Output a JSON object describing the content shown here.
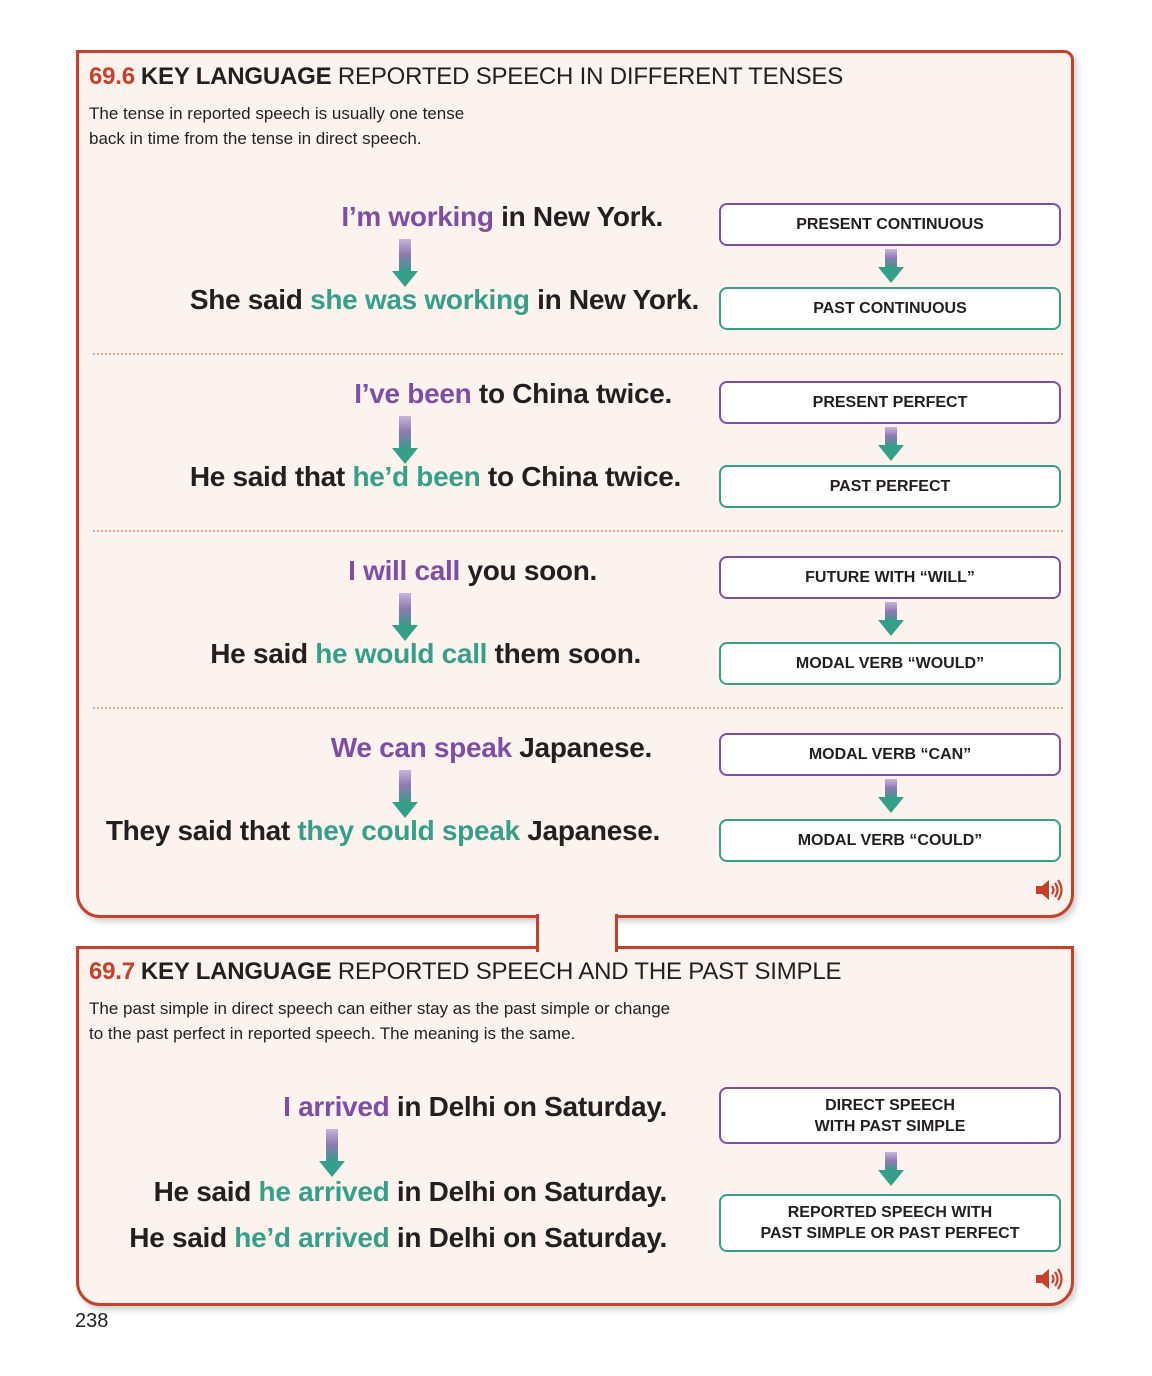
{
  "section1": {
    "number": "69.6",
    "key": "KEY LANGUAGE",
    "title": "REPORTED SPEECH IN DIFFERENT TENSES",
    "intro_line1": "The tense in reported speech is usually one tense",
    "intro_line2": "back in time from the tense in direct speech.",
    "pairs": [
      {
        "direct": {
          "highlight": "I’m working",
          "rest": " in New York."
        },
        "reported": {
          "pre": "She said ",
          "highlight": "she was working",
          "post": " in New York."
        },
        "label_top": "PRESENT CONTINUOUS",
        "label_bottom": "PAST CONTINUOUS"
      },
      {
        "direct": {
          "highlight": "I’ve been",
          "rest": " to China twice."
        },
        "reported": {
          "pre": "He said that ",
          "highlight": "he’d been",
          "post": " to China twice."
        },
        "label_top": "PRESENT PERFECT",
        "label_bottom": "PAST PERFECT"
      },
      {
        "direct": {
          "highlight": "I will call",
          "rest": " you soon."
        },
        "reported": {
          "pre": "He said ",
          "highlight": "he would call",
          "post": " them soon."
        },
        "label_top": "FUTURE WITH “WILL”",
        "label_bottom": "MODAL VERB “WOULD”"
      },
      {
        "direct": {
          "highlight": "We can speak",
          "rest": " Japanese."
        },
        "reported": {
          "pre": "They said that ",
          "highlight": "they could speak",
          "post": " Japanese."
        },
        "label_top": "MODAL VERB “CAN”",
        "label_bottom": "MODAL VERB “COULD”"
      }
    ]
  },
  "section2": {
    "number": "69.7",
    "key": "KEY LANGUAGE",
    "title": "REPORTED SPEECH AND THE PAST SIMPLE",
    "intro_line1": "The past simple in direct speech can either stay as the past simple or change",
    "intro_line2": "to the past perfect in reported speech. The meaning is the same.",
    "direct": {
      "highlight": "I arrived",
      "rest": " in Delhi on Saturday."
    },
    "reported1": {
      "pre": "He said ",
      "highlight": "he arrived",
      "post": " in Delhi on Saturday."
    },
    "reported2": {
      "pre": "He said ",
      "highlight": "he’d arrived",
      "post": " in Delhi on Saturday."
    },
    "label_top": "DIRECT SPEECH\nWITH PAST SIMPLE",
    "label_bottom": "REPORTED SPEECH WITH\nPAST SIMPLE OR PAST PERFECT"
  },
  "page_number": "238",
  "icons": {
    "audio": "speaker-icon",
    "arrow": "arrow-down-icon"
  },
  "colors": {
    "frame": "#c9402a",
    "direct": "#7e4ea6",
    "reported": "#34a08a",
    "panel_bg": "#fcf3ef"
  }
}
